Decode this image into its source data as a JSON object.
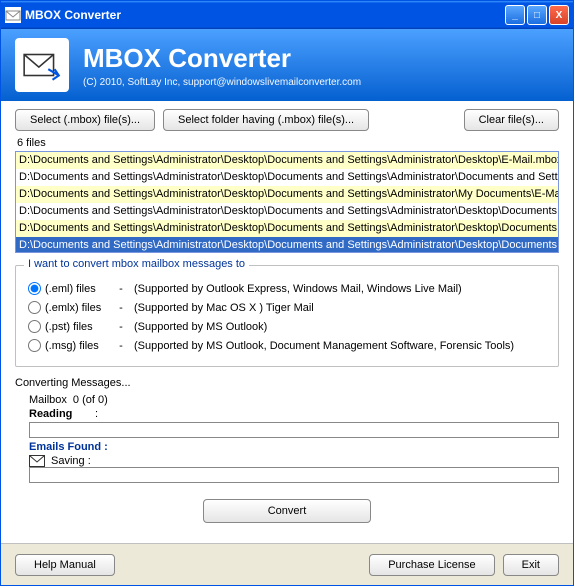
{
  "titlebar": {
    "title": "MBOX Converter"
  },
  "header": {
    "title": "MBOX Converter",
    "copyright": "(C) 2010, SoftLay Inc, support@windowslivemailconverter.com"
  },
  "buttons": {
    "select_mbox": "Select (.mbox) file(s)...",
    "select_folder": "Select folder having (.mbox) file(s)...",
    "clear": "Clear file(s)...",
    "convert": "Convert",
    "help": "Help Manual",
    "purchase": "Purchase License",
    "exit": "Exit"
  },
  "filecount": "6 files",
  "files": [
    {
      "path": "D:\\Documents and Settings\\Administrator\\Desktop\\Documents and Settings\\Administrator\\Desktop\\E-Mail.mbox",
      "alt": true,
      "sel": false
    },
    {
      "path": "D:\\Documents and Settings\\Administrator\\Desktop\\Documents and Settings\\Administrator\\Documents and Settings\\E-M",
      "alt": false,
      "sel": false
    },
    {
      "path": "D:\\Documents and Settings\\Administrator\\Desktop\\Documents and Settings\\Administrator\\My Documents\\E-Mail\\E-Ma",
      "alt": true,
      "sel": false
    },
    {
      "path": "D:\\Documents and Settings\\Administrator\\Desktop\\Documents and Settings\\Administrator\\Desktop\\Documents and S",
      "alt": false,
      "sel": false
    },
    {
      "path": "D:\\Documents and Settings\\Administrator\\Desktop\\Documents and Settings\\Administrator\\Desktop\\Documents and S",
      "alt": true,
      "sel": false
    },
    {
      "path": "D:\\Documents and Settings\\Administrator\\Desktop\\Documents and Settings\\Administrator\\Desktop\\Documents and S",
      "alt": false,
      "sel": true
    }
  ],
  "convert_group": {
    "legend": "I want to convert mbox mailbox messages to",
    "options": [
      {
        "label": "(.eml) files",
        "desc": "(Supported by Outlook Express, Windows Mail, Windows Live Mail)",
        "checked": true
      },
      {
        "label": "(.emlx) files",
        "desc": "(Supported by Mac OS X ) Tiger Mail",
        "checked": false
      },
      {
        "label": "(.pst) files",
        "desc": "(Supported by MS Outlook)",
        "checked": false
      },
      {
        "label": "(.msg) files",
        "desc": "(Supported by MS Outlook, Document Management Software, Forensic Tools)",
        "checked": false
      }
    ]
  },
  "progress": {
    "title": "Converting Messages...",
    "mailbox_label": "Mailbox",
    "mailbox_value": "0 (of 0)",
    "reading_label": "Reading",
    "reading_colon": ":",
    "emails_found": "Emails Found :",
    "saving_label": "Saving :"
  }
}
